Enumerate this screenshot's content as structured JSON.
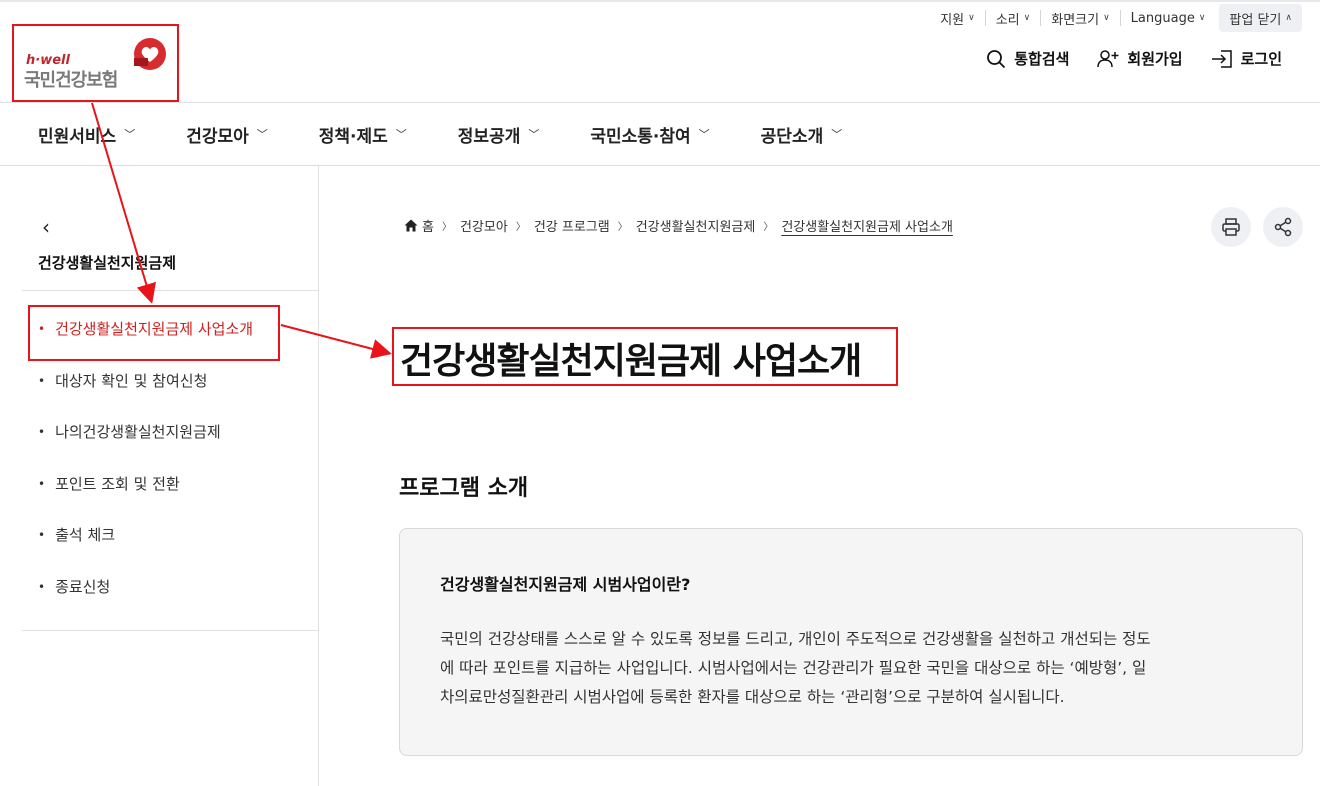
{
  "utility": {
    "items": [
      "지원",
      "소리",
      "화면크기",
      "Language"
    ],
    "popup_close": "팝업 닫기"
  },
  "logo": {
    "tagline": "h·well",
    "name": "국민건강보험"
  },
  "header": {
    "search": "통합검색",
    "signup": "회원가입",
    "login": "로그인"
  },
  "gnb": {
    "items": [
      "민원서비스",
      "건강모아",
      "정책·제도",
      "정보공개",
      "국민소통·참여",
      "공단소개"
    ]
  },
  "sidebar": {
    "title": "건강생활실천지원금제",
    "items": [
      {
        "label": "건강생활실천지원금제 사업소개",
        "active": true
      },
      {
        "label": "대상자 확인 및 참여신청"
      },
      {
        "label": "나의건강생활실천지원금제"
      },
      {
        "label": "포인트 조회 및 전환"
      },
      {
        "label": "출석 체크"
      },
      {
        "label": "종료신청"
      }
    ]
  },
  "breadcrumb": {
    "home": "홈",
    "items": [
      "건강모아",
      "건강 프로그램",
      "건강생활실천지원금제",
      "건강생활실천지원금제 사업소개"
    ]
  },
  "main": {
    "title": "건강생활실천지원금제 사업소개",
    "section_title": "프로그램 소개",
    "info_head": "건강생활실천지원금제 시범사업이란?",
    "info_lines": [
      "국민의 건강상태를 스스로 알 수 있도록 정보를 드리고, 개인이 주도적으로 건강생활을 실천하고 개선되는 정도",
      "에 따라 포인트를 지급하는 사업입니다. 시범사업에서는 건강관리가 필요한 국민을 대상으로 하는 ‘예방형’, 일",
      "차의료만성질환관리 시범사업에 등록한 환자를 대상으로 하는 ‘관리형’으로 구분하여 실시됩니다."
    ]
  },
  "colors": {
    "brand_red": "#c0272d",
    "annotation_red": "#e8141a",
    "active_menu": "#d12020"
  }
}
